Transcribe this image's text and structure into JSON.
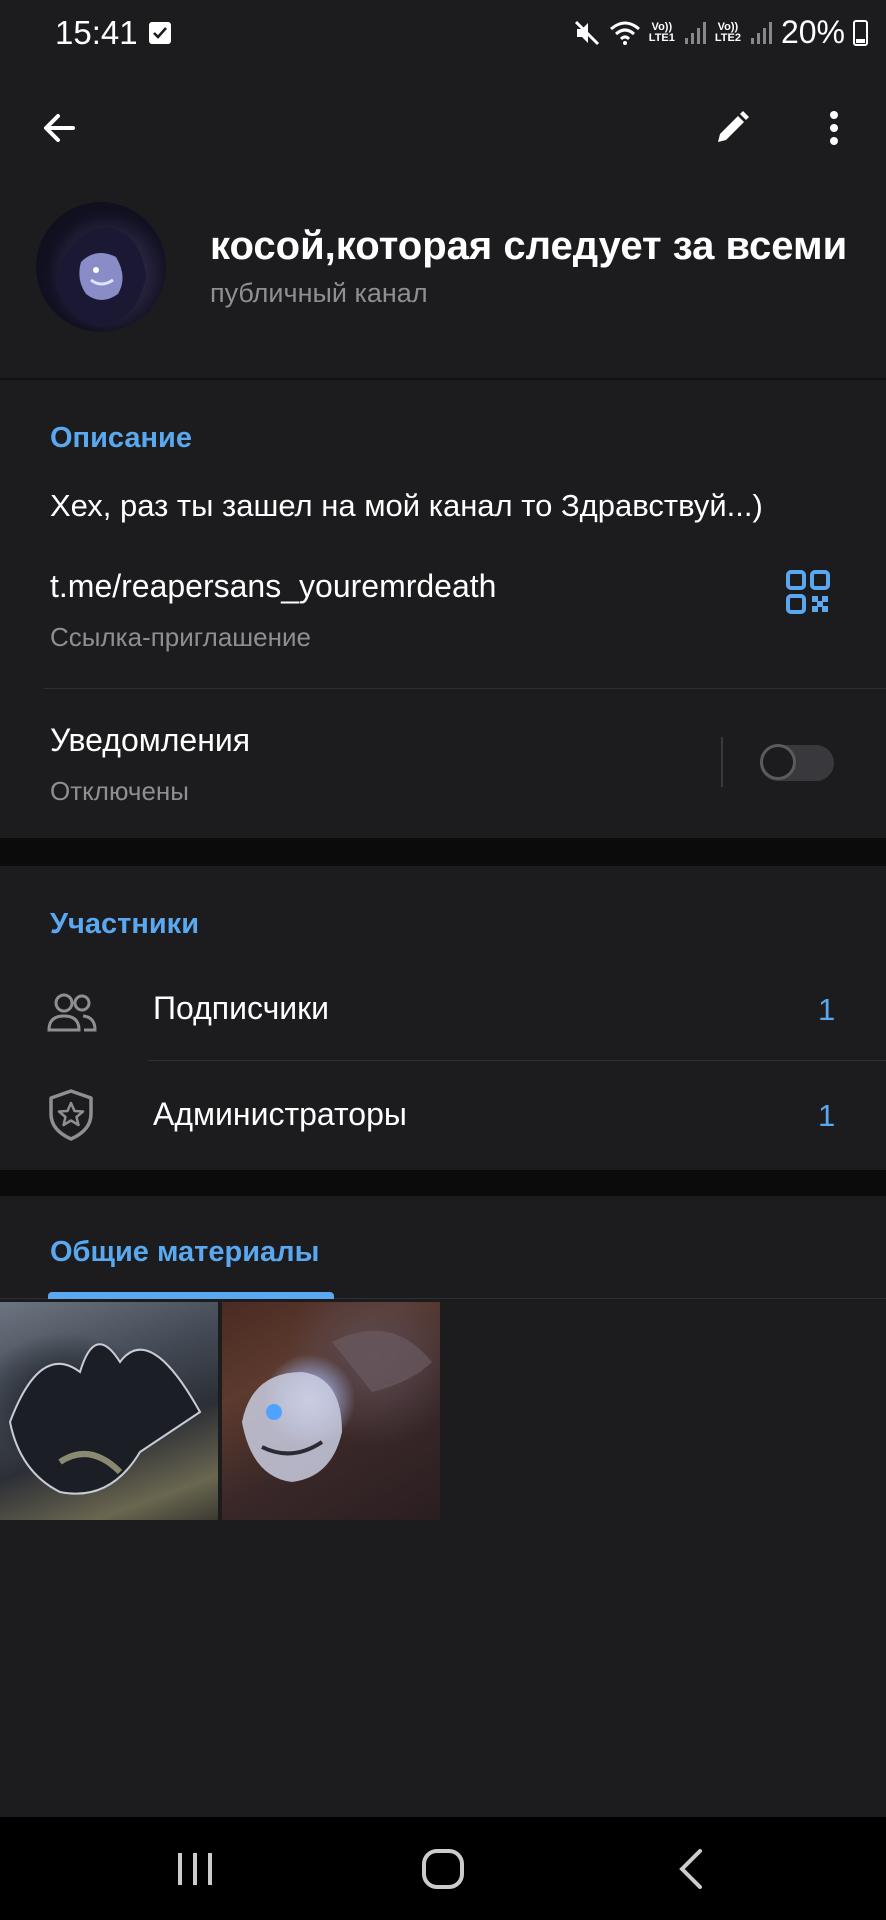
{
  "status_bar": {
    "time": "15:41",
    "network_1": "Vo))\nLTE1",
    "network_2": "Vo))\nLTE2",
    "battery": "20%"
  },
  "app_bar": {
    "back_icon": "arrow-left-icon",
    "edit_icon": "pencil-icon",
    "more_icon": "more-vertical-icon"
  },
  "channel": {
    "title": "косой,которая следует за всеми",
    "subtitle": "публичный канал"
  },
  "info": {
    "description_header": "Описание",
    "description": "Хех, раз ты зашел на мой канал то Здравствуй...)",
    "link": "t.me/reapersans_youremrdeath",
    "link_label": "Ссылка-приглашение",
    "notifications_label": "Уведомления",
    "notifications_state": "Отключены"
  },
  "members": {
    "header": "Участники",
    "subscribers_label": "Подписчики",
    "subscribers_count": "1",
    "admins_label": "Администраторы",
    "admins_count": "1"
  },
  "media": {
    "header": "Общие материалы"
  },
  "colors": {
    "accent": "#5aa8f0",
    "background": "#1c1c1e",
    "separator": "#0b0b0c"
  }
}
